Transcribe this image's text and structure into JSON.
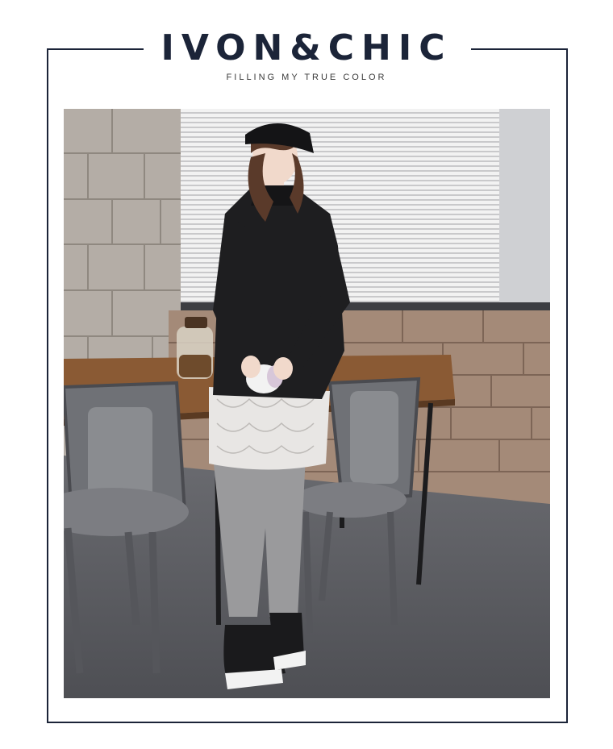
{
  "header": {
    "brand": "IVON&CHIC",
    "tagline": "FILLING MY TRUE COLOR"
  },
  "photo": {
    "description_icon": "fashion-model-photo",
    "colors": {
      "frame": "#1b2438",
      "sweater": "#1e1e20",
      "leggings": "#9a9a9c",
      "wall": "#a88f7e",
      "floor": "#5d5e63"
    }
  }
}
